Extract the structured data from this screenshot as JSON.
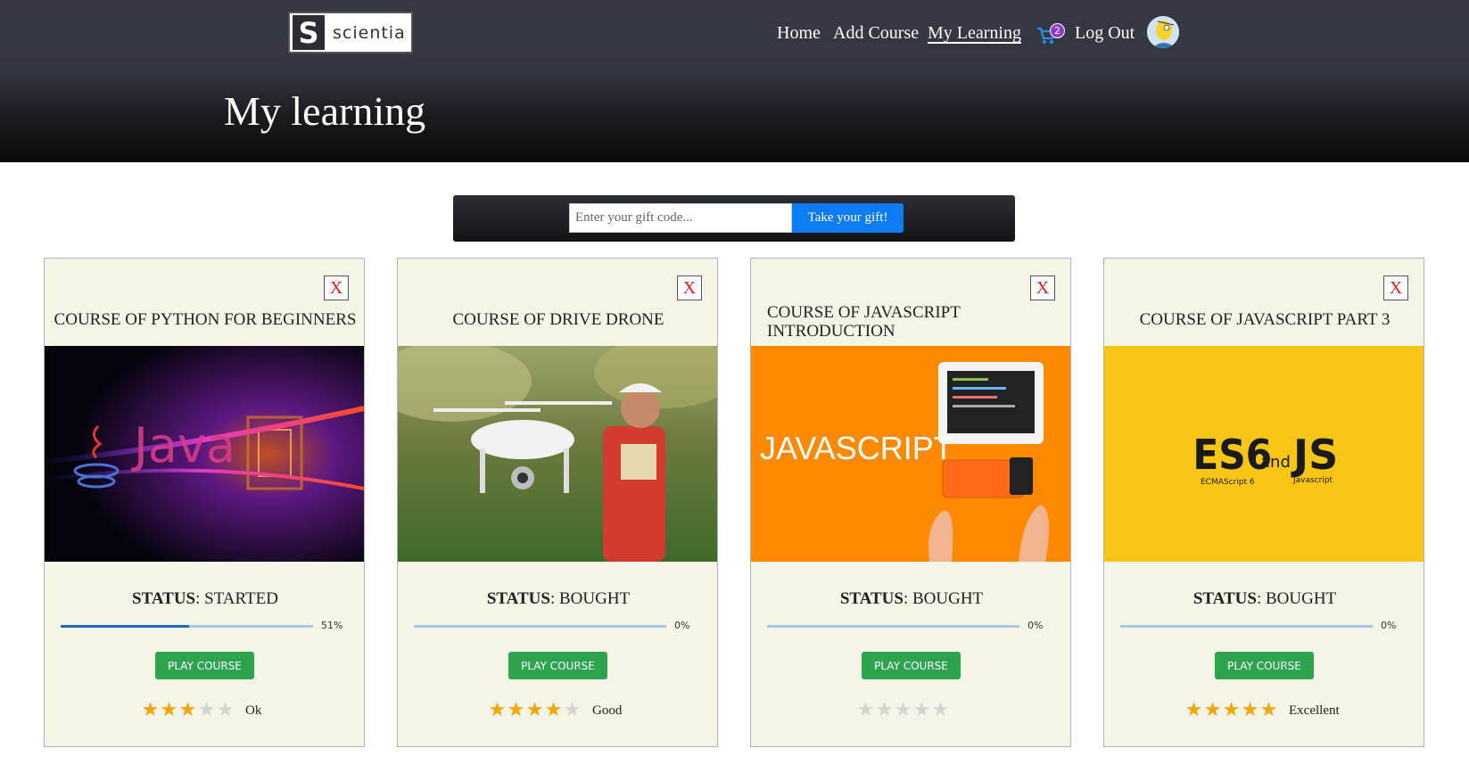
{
  "logo": {
    "mark": "S",
    "text": "scientia"
  },
  "nav": {
    "home": "Home",
    "add_course": "Add Course",
    "my_learning": "My Learning",
    "cart_count": "2",
    "logout": "Log Out"
  },
  "page_title": "My learning",
  "gift": {
    "placeholder": "Enter your gift code...",
    "button": "Take your gift!"
  },
  "colors": {
    "star_filled": "#f5a500",
    "star_empty": "#d3d3d3",
    "play_button": "#2ea44f",
    "gift_button": "#0d7bf1",
    "progress": "#1d6bb7"
  },
  "courses": [
    {
      "title": "COURSE OF PYTHON FOR BEGINNERS",
      "close": "X",
      "image": "java-image",
      "status_label": "STATUS",
      "status": ": STARTED",
      "progress": 0.51,
      "progress_text": "51%",
      "play": "PLAY COURSE",
      "rating": 3,
      "rating_label": "Ok"
    },
    {
      "title": "COURSE OF DRIVE DRONE",
      "close": "X",
      "image": "drone-image",
      "status_label": "STATUS",
      "status": ": BOUGHT",
      "progress": 0,
      "progress_text": "0%",
      "play": "PLAY COURSE",
      "rating": 4,
      "rating_label": "Good"
    },
    {
      "title": "COURSE OF JAVASCRIPT INTRODUCTION",
      "close": "X",
      "image": "javascript-image",
      "image_text": "JAVASCRIPT",
      "status_label": "STATUS",
      "status": ": BOUGHT",
      "progress": 0,
      "progress_text": "0%",
      "play": "PLAY COURSE",
      "rating": 0,
      "rating_label": ""
    },
    {
      "title": "COURSE OF JAVASCRIPT PART 3",
      "close": "X",
      "image": "es6-js-image",
      "image_text": {
        "es6": "ES6",
        "and": "and",
        "js": "JS",
        "ecma": "ECMAScript 6",
        "javascript": "Javascript"
      },
      "status_label": "STATUS",
      "status": ": BOUGHT",
      "progress": 0,
      "progress_text": "0%",
      "play": "PLAY COURSE",
      "rating": 5,
      "rating_label": "Excellent"
    }
  ]
}
